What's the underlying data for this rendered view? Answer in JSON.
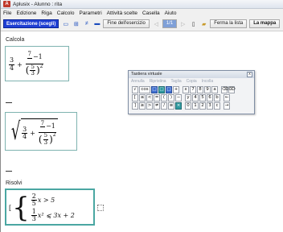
{
  "window": {
    "logo_text": "A",
    "title": "Aplusix - Alunno : rita"
  },
  "menu": [
    "File",
    "Edizione",
    "Riga",
    "Calcolo",
    "Parametri",
    "Attività scelte",
    "Casella",
    "Aiuto"
  ],
  "toolbar": {
    "exercise_select": "Esercitazione (scegli)",
    "end_exercises": "Fine dell'esercizio",
    "page": "1/1",
    "close_list": "Ferma la lista",
    "map": "La mappa"
  },
  "sections": {
    "calcola": "Calcola",
    "risolvi": "Risolvi"
  },
  "math": {
    "expr1": {
      "a_num": "3",
      "a_den": "4",
      "op": "+",
      "b_num": "7",
      "b_minus": "−1",
      "c_num": "5",
      "c_den": "3",
      "exp": "2"
    },
    "expr2": {
      "a_num": "3",
      "a_den": "4",
      "op": "+",
      "b_num": "7",
      "b_minus": "−1",
      "c_num": "5",
      "c_den": "3",
      "exp": "2"
    },
    "system": {
      "row1": {
        "num": "2",
        "den": "5",
        "tail": "x > 5"
      },
      "row2": {
        "num": "1",
        "den": "3",
        "tail": "x² ⩽ 3x + 2"
      }
    }
  },
  "keyboard": {
    "title": "Tastiera virtuale",
    "close": "x",
    "menu": [
      "Annulla",
      "Ripristina",
      "Taglia",
      "Copia",
      "Incolla"
    ],
    "row1": [
      "√",
      "cos",
      "□",
      "□",
      "□",
      "+",
      "x",
      "7",
      "8",
      "9",
      "a",
      "⌫",
      "⌦"
    ],
    "row2": [
      "[",
      "≤",
      "<",
      "=",
      "(",
      ")",
      "−",
      "y",
      "4",
      "5",
      "6",
      "b",
      "←"
    ],
    "row3": [
      "]",
      "≥",
      ">",
      "≠",
      "/",
      "≡",
      "×",
      "0",
      "1",
      "2",
      "3",
      "c",
      "→"
    ],
    "enter": "↵"
  }
}
